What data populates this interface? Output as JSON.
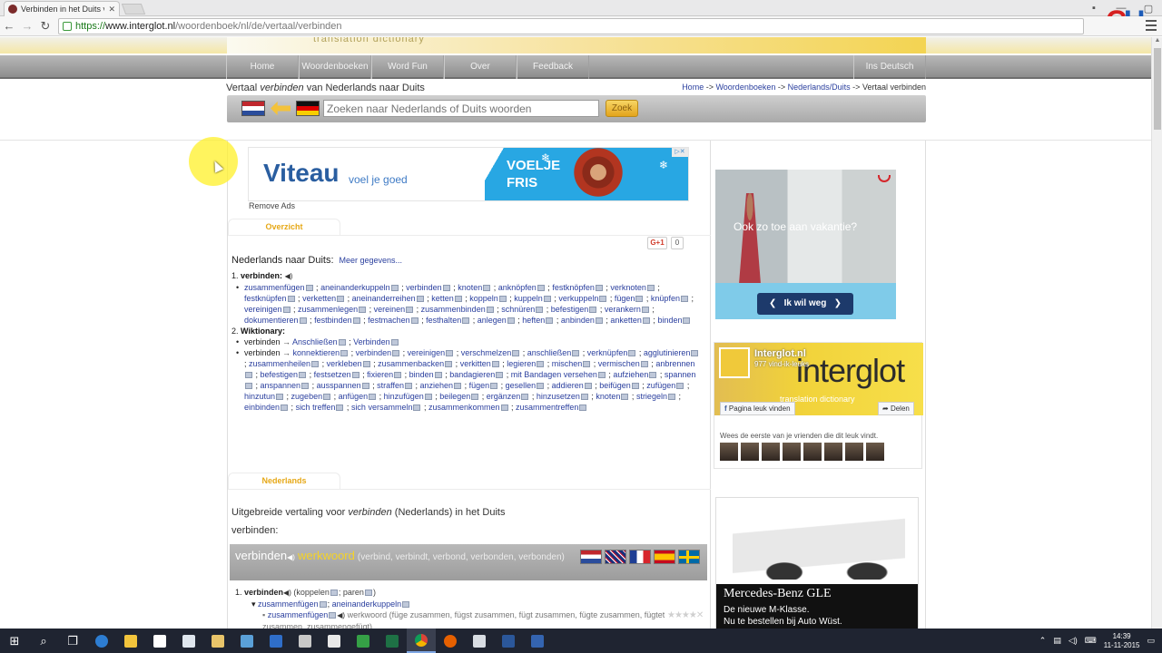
{
  "browser": {
    "tab_title": "Verbinden in het Duits ve",
    "url_scheme": "https://",
    "url_host": "www.interglot.nl",
    "url_path": "/woordenboek/nl/de/vertaal/verbinden"
  },
  "site": {
    "watermark": "translation dictionary",
    "menu": [
      "Home",
      "Woordenboeken",
      "Word Fun",
      "Over",
      "Feedback"
    ],
    "menu_right": "Ins Deutsch",
    "page_title_pre": "Vertaal ",
    "page_title_word": "verbinden",
    "page_title_post": " van Nederlands naar Duits",
    "breadcrumb": [
      {
        "label": "Home"
      },
      {
        "label": "Woordenboeken"
      },
      {
        "label": "Nederlands/Duits"
      },
      {
        "label": "Vertaal verbinden"
      }
    ],
    "breadcrumb_sep": " -> ",
    "search_placeholder": "Zoeken naar Nederlands of Duits woorden",
    "search_button": "Zoek"
  },
  "ad_top": {
    "brand": "Viteau",
    "tagline": "voel je goed",
    "line1": "VOELJE",
    "line2": "FRIS",
    "remove_ads": "Remove Ads"
  },
  "overview": {
    "tab": "Overzicht",
    "gplus": "G+1",
    "gplus_count": "0",
    "heading": "Nederlands naar Duits:",
    "more": "Meer gegevens...",
    "entry1_num": "1.",
    "entry1_word": "verbinden:",
    "entry1_words": [
      "zusammenfügen",
      "aneinanderkuppeln",
      "verbinden",
      "knoten",
      "anknöpfen",
      "festknöpfen",
      "verknoten",
      "festknüpfen",
      "verketten",
      "aneinanderreihen",
      "ketten",
      "koppeln",
      "kuppeln",
      "verkuppeln",
      "fügen",
      "knüpfen",
      "vereinigen",
      "zusammenlegen",
      "vereinen",
      "zusammenbinden",
      "schnüren",
      "befestigen",
      "verankern",
      "dokumentieren",
      "festbinden",
      "festmachen",
      "festhalten",
      "anlegen",
      "heften",
      "anbinden",
      "anketten",
      "binden"
    ],
    "entry2_num": "2.",
    "entry2_word": "Wiktionary:",
    "wk1_head": "verbinden",
    "wk1_words": [
      "Anschließen",
      "Verbinden"
    ],
    "wk2_head": "verbinden",
    "wk2_words": [
      "konnektieren",
      "verbinden",
      "vereinigen",
      "verschmelzen",
      "anschließen",
      "verknüpfen",
      "agglutinieren",
      "zusammenheilen",
      "verkleben",
      "zusammenbacken",
      "verkitten",
      "legieren",
      "mischen",
      "vermischen",
      "anbrennen",
      "befestigen",
      "festsetzen",
      "fixieren",
      "binden",
      "bandagieren",
      "mit Bandagen versehen",
      "aufziehen",
      "spannen",
      "anspannen",
      "ausspannen",
      "straffen",
      "anziehen",
      "fügen",
      "gesellen",
      "addieren",
      "beifügen",
      "zufügen",
      "hinzutun",
      "zugeben",
      "anfügen",
      "hinzufügen",
      "beilegen",
      "ergänzen",
      "hinzusetzen",
      "knoten",
      "striegeln",
      "einbinden",
      "sich treffen",
      "sich versammeln",
      "zusammenkommen",
      "zusammentreffen"
    ]
  },
  "detail": {
    "tab": "Nederlands",
    "intro_pre": "Uitgebreide vertaling voor ",
    "intro_word": "verbinden",
    "intro_post": " (Nederlands) in het Duits",
    "label": "verbinden:",
    "bar_word": "verbinden",
    "bar_pos": "werkwoord",
    "bar_forms": "(verbind, verbindt, verbond, verbonden, verbonden)",
    "d1_num": "1.",
    "d1_word": "verbinden",
    "d1_syn": "(koppelen",
    "d1_syn2": "; paren",
    "d1_syn_end": ")",
    "d1_sub1": "zusammenfügen",
    "d1_sub2": "aneinanderkuppeln",
    "d1_item": "zusammenfügen",
    "d1_item_pos": "werkwoord",
    "d1_item_forms": "(füge zusammen, fügst zusammen, fügt zusammen, fügte zusammen, fügtet zusammen, zusammengefügt)"
  },
  "sidebar": {
    "ad_text": "Ook zo toe aan vakantie?",
    "ad_button": "Ik wil weg",
    "fb_page": "Interglot.nl",
    "fb_likes": "977 vind-ik-leuks",
    "fb_big": "interglot",
    "fb_sub": "translation dictionary",
    "fb_like_btn": "Pagina leuk vinden",
    "fb_share_btn": "Delen",
    "fb_friends": "Wees de eerste van je vrienden die dit leuk vindt.",
    "car_brand": "Mercedes-Benz GLE",
    "car_line1": "De nieuwe M-Klasse.",
    "car_line2": "Nu te bestellen bij Auto Wüst."
  },
  "taskbar": {
    "time": "14:39",
    "date": "11-11-2015"
  },
  "colors": {
    "accent_yellow": "#f3c23b",
    "link_blue": "#2a3f9e",
    "menu_grey": "#9e9e9e"
  }
}
